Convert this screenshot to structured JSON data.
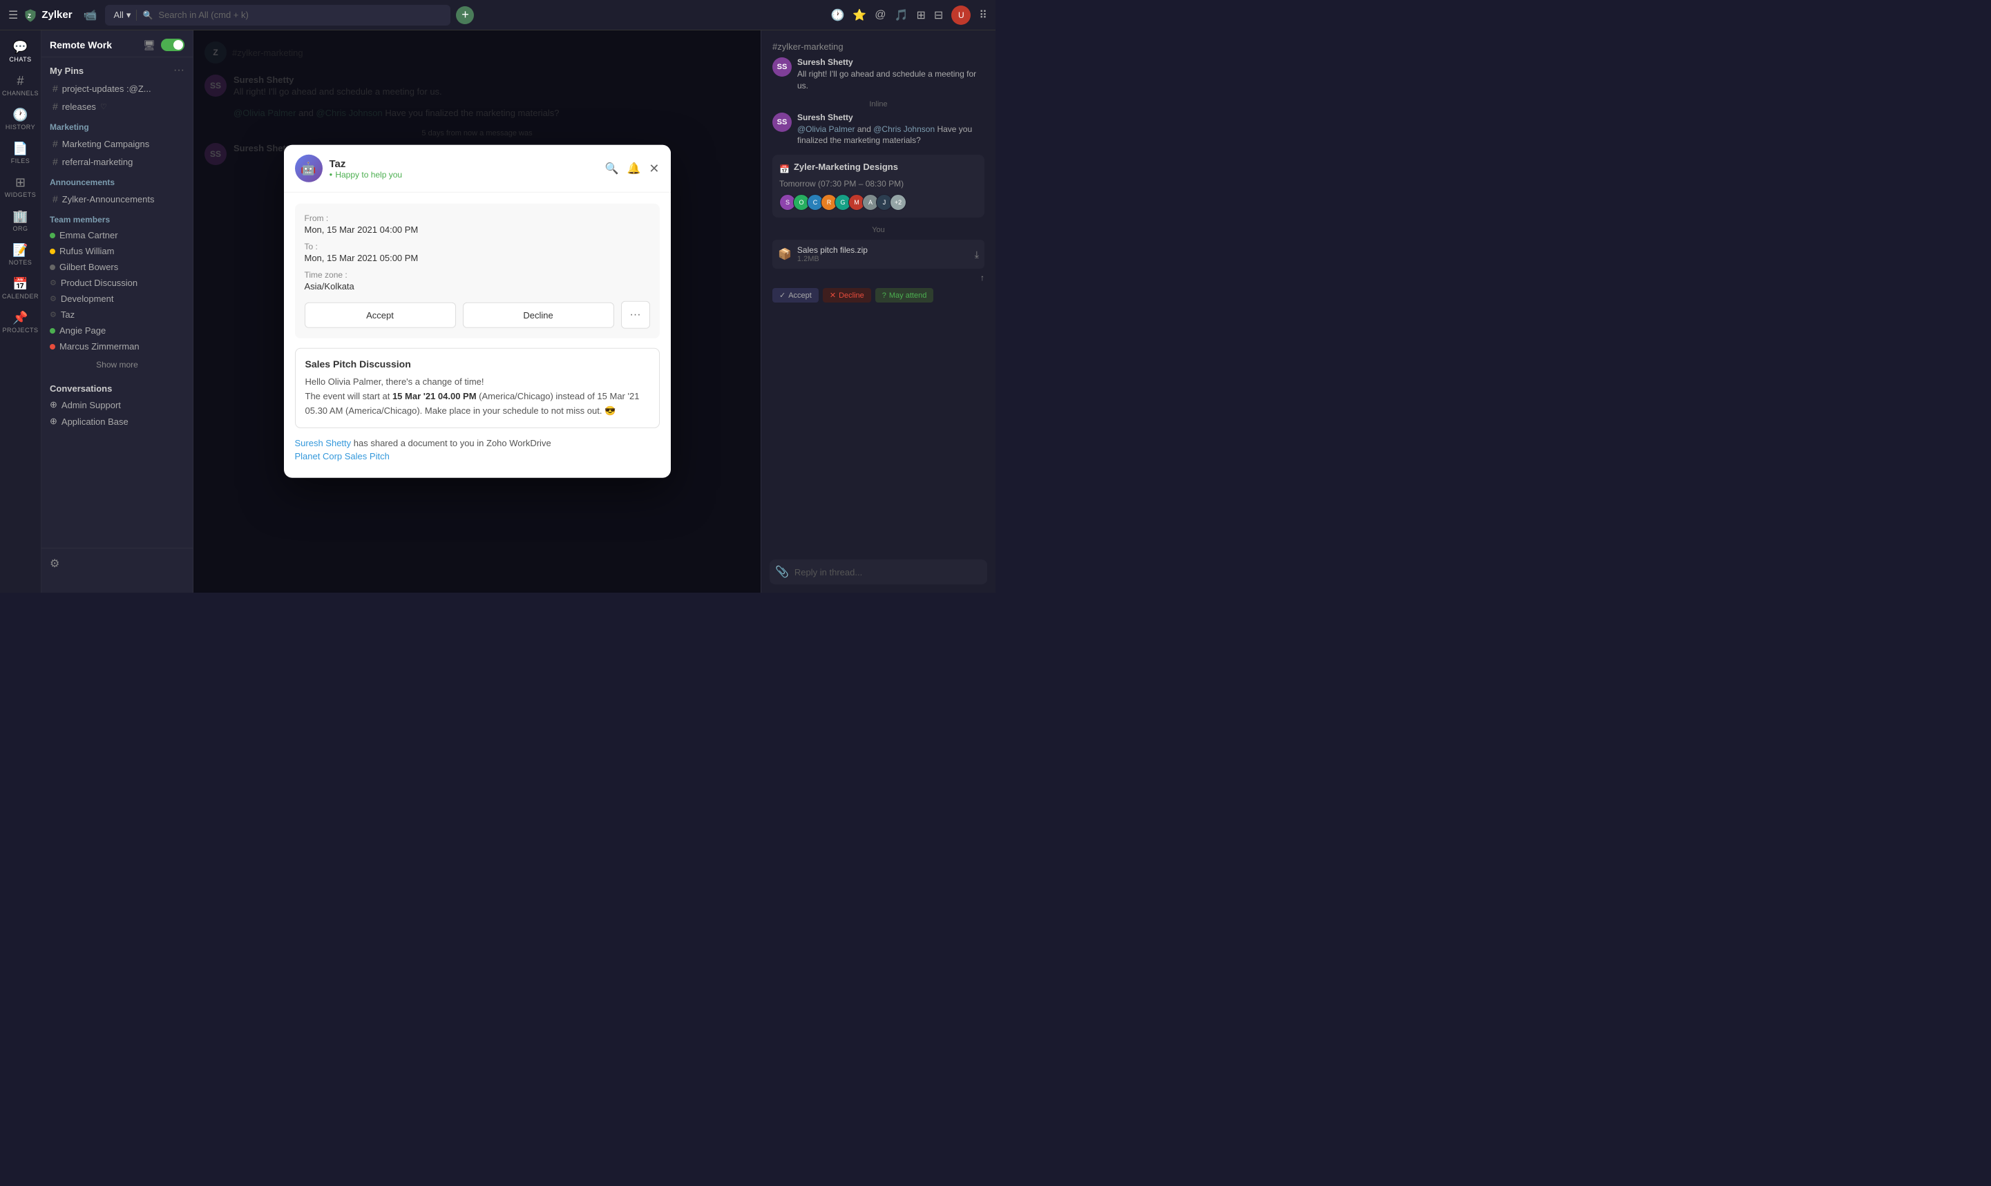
{
  "topbar": {
    "menu_label": "☰",
    "logo_text": "Zylker",
    "cam_icon": "📹",
    "search_placeholder": "Search in All (cmd + k)",
    "search_filter": "All",
    "plus_label": "+",
    "right_icons": [
      "🕐",
      "⭐",
      "@",
      "🎵",
      "⊞",
      "⊟",
      "👤",
      "⠿"
    ]
  },
  "sidebar": {
    "items": [
      {
        "id": "chats",
        "icon": "💬",
        "label": "CHATS"
      },
      {
        "id": "channels",
        "icon": "#",
        "label": "CHANNELS"
      },
      {
        "id": "history",
        "icon": "🕐",
        "label": "HISTORY"
      },
      {
        "id": "files",
        "icon": "📄",
        "label": "FILES"
      },
      {
        "id": "widgets",
        "icon": "⊞",
        "label": "WIDGETS"
      },
      {
        "id": "org",
        "icon": "🏢",
        "label": "ORG"
      },
      {
        "id": "notes",
        "icon": "📝",
        "label": "NOTES"
      },
      {
        "id": "calendar",
        "icon": "📅",
        "label": "CALENDER"
      },
      {
        "id": "projects",
        "icon": "📌",
        "label": "PROJECTS"
      }
    ]
  },
  "left_panel": {
    "workspace": "Remote Work",
    "my_pins_title": "My Pins",
    "pins": [
      {
        "name": "project-updates :@Z...",
        "type": "hash"
      },
      {
        "name": "releases",
        "type": "hash",
        "has_icon": true
      }
    ],
    "marketing_title": "Marketing",
    "marketing_channels": [
      {
        "name": "Marketing Campaigns"
      },
      {
        "name": "referral-marketing"
      }
    ],
    "announcements_title": "Announcements",
    "announcements_channels": [
      {
        "name": "Zylker-Announcements"
      }
    ],
    "team_members_title": "Team members",
    "members": [
      {
        "name": "Emma Cartner",
        "status": "green"
      },
      {
        "name": "Rufus William",
        "status": "yellow"
      },
      {
        "name": "Gilbert Bowers",
        "status": "gray"
      },
      {
        "name": "Product Discussion",
        "status": "gear"
      },
      {
        "name": "Development",
        "status": "gear"
      },
      {
        "name": "Taz",
        "status": "gear"
      },
      {
        "name": "Angie Page",
        "status": "green"
      },
      {
        "name": "Marcus Zimmerman",
        "status": "red"
      }
    ],
    "show_more_label": "Show more",
    "conversations_title": "Conversations",
    "conversations": [
      {
        "name": "Admin Support"
      },
      {
        "name": "Application Base"
      }
    ],
    "settings_icon": "⚙"
  },
  "modal": {
    "bot_name": "Taz",
    "bot_status": "Happy to help you",
    "search_icon": "🔍",
    "bell_icon": "🔔",
    "close_icon": "✕",
    "event": {
      "from_label": "From :",
      "from_value": "Mon, 15 Mar 2021 04:00 PM",
      "to_label": "To :",
      "to_value": "Mon, 15 Mar 2021 05:00 PM",
      "timezone_label": "Time zone :",
      "timezone_value": "Asia/Kolkata",
      "accept_label": "Accept",
      "decline_label": "Decline",
      "more_label": "···"
    },
    "pitch": {
      "title": "Sales Pitch Discussion",
      "greeting": "Hello Olivia Palmer, there's a change of time!",
      "body1": "The event will start at ",
      "bold_date": "15 Mar '21 04.00 PM",
      "body2": " (America/Chicago) instead of 15 Mar '21 05.30 AM (America/Chicago). Make place in your schedule to not miss out. 😎"
    },
    "shared": {
      "shared_by": "Suresh Shetty",
      "shared_text": " has shared a document to you in Zoho WorkDrive",
      "doc_name": "Planet Corp Sales Pitch"
    }
  },
  "right_panel": {
    "channel_name": "#zylker-marketing",
    "messages": [
      {
        "name": "Suresh Shetty",
        "text": "All right! I'll go ahead and schedule a meeting for us.",
        "bg": "#8e44ad"
      },
      {
        "name": "Suresh Shetty",
        "text": "and  . Have you finalized the marketing materials?",
        "mentions": [
          "@Olivia Palmer",
          "@Chris Johnson"
        ],
        "bg": "#8e44ad"
      }
    ],
    "card": {
      "title": "Zyler-Marketing Designs",
      "time": "Tomorrow (07:30 PM – 08:30 PM)",
      "avatars": [
        "S",
        "O",
        "C",
        "R",
        "G",
        "M",
        "A",
        "J",
        "+2"
      ]
    },
    "file": {
      "name": "Sales pitch files.zip",
      "size": "1.2MB",
      "icon": "📦"
    },
    "actions": {
      "accept": "Accept",
      "decline": "Decline",
      "may_attend": "May attend"
    },
    "input_placeholder": "Reply in thread...",
    "attach_icon": "📎"
  },
  "background_chat": {
    "sender": "You",
    "label": "You"
  }
}
